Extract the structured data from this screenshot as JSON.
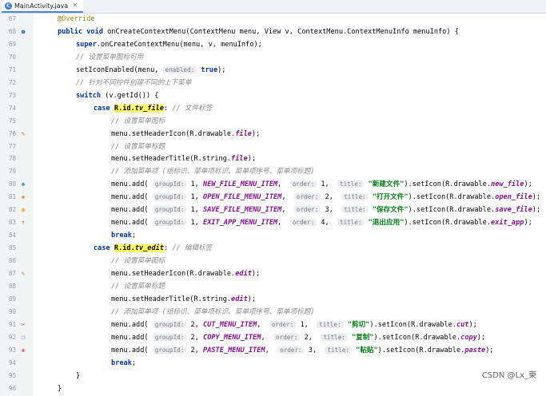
{
  "tab": {
    "title": "MainActivity.java",
    "icon": "java-class-icon"
  },
  "lines": [
    {
      "n": "67",
      "html": "<span class='ann'>@Override</span>",
      "indent": 72,
      "icon": ""
    },
    {
      "n": "68",
      "html": "<span class='kw'>public void</span> onCreateContextMenu(ContextMenu menu, View v, ContextMenu.ContextMenuInfo menuInfo) {",
      "indent": 72,
      "icon": "override-icon"
    },
    {
      "n": "69",
      "html": "<span class='kw'>super</span>.onCreateContextMenu(menu, v, menuInfo);",
      "indent": 95,
      "icon": ""
    },
    {
      "n": "70",
      "html": "<span class='cm'>// 设置菜单图标可用</span>",
      "indent": 95,
      "icon": ""
    },
    {
      "n": "71",
      "html": "setIconEnabled(menu, <span class='hint'>enabled:</span> <span class='kw'>true</span>);",
      "indent": 95,
      "icon": ""
    },
    {
      "n": "72",
      "html": "<span class='cm'>// 针对不同控件创建不同的上下菜单</span>",
      "indent": 95,
      "icon": ""
    },
    {
      "n": "73",
      "html": "<span class='kw'>switch</span> (v.getId()) {",
      "indent": 95,
      "icon": ""
    },
    {
      "n": "74",
      "html": "<span class='kw'>case</span> <span class='hl'>R.id.<i>tv_file</i></span>: <span class='cm'>// 文件标签</span>",
      "indent": 117,
      "icon": ""
    },
    {
      "n": "75",
      "html": "<span class='cm'>// 设置菜单图标</span>",
      "indent": 139,
      "icon": ""
    },
    {
      "n": "76",
      "html": "menu.setHeaderIcon(R.drawable.<span class='fld'>file</span>);",
      "indent": 139,
      "icon": "file-icon"
    },
    {
      "n": "77",
      "html": "<span class='cm'>// 设置菜单标题</span>",
      "indent": 139,
      "icon": ""
    },
    {
      "n": "78",
      "html": "menu.setHeaderTitle(R.string.<span class='fld'>file</span>);",
      "indent": 139,
      "icon": ""
    },
    {
      "n": "79",
      "html": "<span class='cm'>// 添加菜单项 (组标识、菜单项标识、菜单项序号、菜单项标题)</span>",
      "indent": 139,
      "icon": ""
    },
    {
      "n": "80",
      "html": "menu.add( <span class='hint'>groupId:</span> 1, <span class='fld'>NEW_FILE_MENU_ITEM</span>,  <span class='hint'>order:</span> 1,  <span class='hint'>title:</span> <span class='str'>\"新建文件\"</span>).setIcon(R.drawable.<span class='fld'>new_file</span>);",
      "indent": 139,
      "icon": "new-file-icon"
    },
    {
      "n": "81",
      "html": "menu.add( <span class='hint'>groupId:</span> 1, <span class='fld'>OPEN_FILE_MENU_ITEM</span>,  <span class='hint'>order:</span> 2,  <span class='hint'>title:</span> <span class='str'>\"打开文件\"</span>).setIcon(R.drawable.<span class='fld'>open_file</span>);",
      "indent": 139,
      "icon": "open-file-icon"
    },
    {
      "n": "82",
      "html": "menu.add( <span class='hint'>groupId:</span> 1, <span class='fld'>SAVE_FILE_MENU_ITEM</span>,  <span class='hint'>order:</span> 3,  <span class='hint'>title:</span> <span class='str'>\"保存文件\"</span>).setIcon(R.drawable.<span class='fld'>save_file</span>);",
      "indent": 139,
      "icon": "save-file-icon"
    },
    {
      "n": "83",
      "html": "menu.add( <span class='hint'>groupId:</span> 1, <span class='fld'>EXIT_APP_MENU_ITEM</span>,  <span class='hint'>order:</span> 4,  <span class='hint'>title:</span> <span class='str'>\"退出应用\"</span>).setIcon(R.drawable.<span class='fld'>exit_app</span>);",
      "indent": 139,
      "icon": "exit-app-icon"
    },
    {
      "n": "84",
      "html": "<span class='kw'>break</span>;",
      "indent": 139,
      "icon": ""
    },
    {
      "n": "85",
      "html": "<span class='kw'>case</span> <span class='hl'>R.id.<i>tv_edit</i></span>: <span class='cm'>// 编辑标签</span>",
      "indent": 117,
      "icon": ""
    },
    {
      "n": "86",
      "html": "<span class='cm'>// 设置菜单图标</span>",
      "indent": 139,
      "icon": ""
    },
    {
      "n": "87",
      "html": "menu.setHeaderIcon(R.drawable.<span class='fld'>edit</span>);",
      "indent": 139,
      "icon": "edit-icon"
    },
    {
      "n": "88",
      "html": "<span class='cm'>// 设置菜单标题</span>",
      "indent": 139,
      "icon": ""
    },
    {
      "n": "89",
      "html": "menu.setHeaderTitle(R.string.<span class='fld'>edit</span>);",
      "indent": 139,
      "icon": ""
    },
    {
      "n": "90",
      "html": "<span class='cm'>// 添加菜单项 (组标识、菜单项标识、菜单项序号、菜单项标题)</span>",
      "indent": 139,
      "icon": ""
    },
    {
      "n": "91",
      "html": "menu.add( <span class='hint'>groupId:</span> 2, <span class='fld'>CUT_MENU_ITEM</span>,  <span class='hint'>order:</span> 1,  <span class='hint'>title:</span> <span class='str'>\"剪切\"</span>).setIcon(R.drawable.<span class='fld'>cut</span>);",
      "indent": 139,
      "icon": "cut-icon"
    },
    {
      "n": "92",
      "html": "menu.add( <span class='hint'>groupId:</span> 2, <span class='fld'>COPY_MENU_ITEM</span>,  <span class='hint'>order:</span> 2,  <span class='hint'>title:</span> <span class='str'>\"复制\"</span>).setIcon(R.drawable.<span class='fld'>copy</span>);",
      "indent": 139,
      "icon": "copy-icon"
    },
    {
      "n": "93",
      "html": "menu.add( <span class='hint'>groupId:</span> 2, <span class='fld'>PASTE_MENU_ITEM</span>,  <span class='hint'>order:</span> 3,  <span class='hint'>title:</span> <span class='str'>\"粘贴\"</span>).setIcon(R.drawable.<span class='fld'>paste</span>);",
      "indent": 139,
      "icon": "paste-icon"
    },
    {
      "n": "94",
      "html": "<span class='kw'>break</span>;",
      "indent": 139,
      "icon": ""
    },
    {
      "n": "95",
      "html": "}",
      "indent": 95,
      "icon": ""
    },
    {
      "n": "96",
      "html": "}",
      "indent": 72,
      "icon": ""
    }
  ],
  "watermark": "CSDN @Lx_東"
}
